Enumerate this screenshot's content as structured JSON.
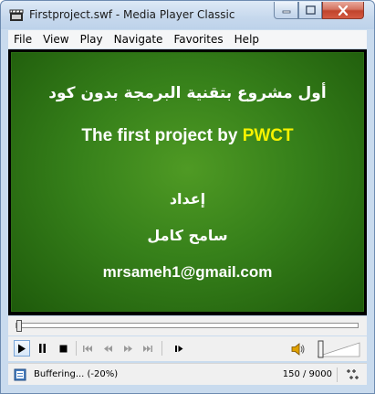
{
  "window": {
    "title": "Firstproject.swf - Media Player Classic"
  },
  "menu": {
    "items": [
      "File",
      "View",
      "Play",
      "Navigate",
      "Favorites",
      "Help"
    ]
  },
  "video": {
    "line1": "أول مشروع  بتقنية البرمجة بدون كود",
    "line2_prefix": "The first project by ",
    "line2_highlight": "PWCT",
    "line3": "إعداد",
    "line4": "سامح كامل",
    "line5": "mrsameh1@gmail.com",
    "background_color": "#36801a",
    "highlight_color": "#f6f200"
  },
  "seek": {
    "position_fraction": 0.0
  },
  "toolbar": {
    "buttons": [
      "play-icon",
      "pause-icon",
      "stop-icon",
      "skip-back-icon",
      "rewind-icon",
      "fast-forward-icon",
      "skip-forward-icon",
      "frame-step-icon"
    ],
    "volume_icon": "speaker-icon"
  },
  "status": {
    "text": "Buffering... (-20%)",
    "frames": "150 / 9000"
  }
}
